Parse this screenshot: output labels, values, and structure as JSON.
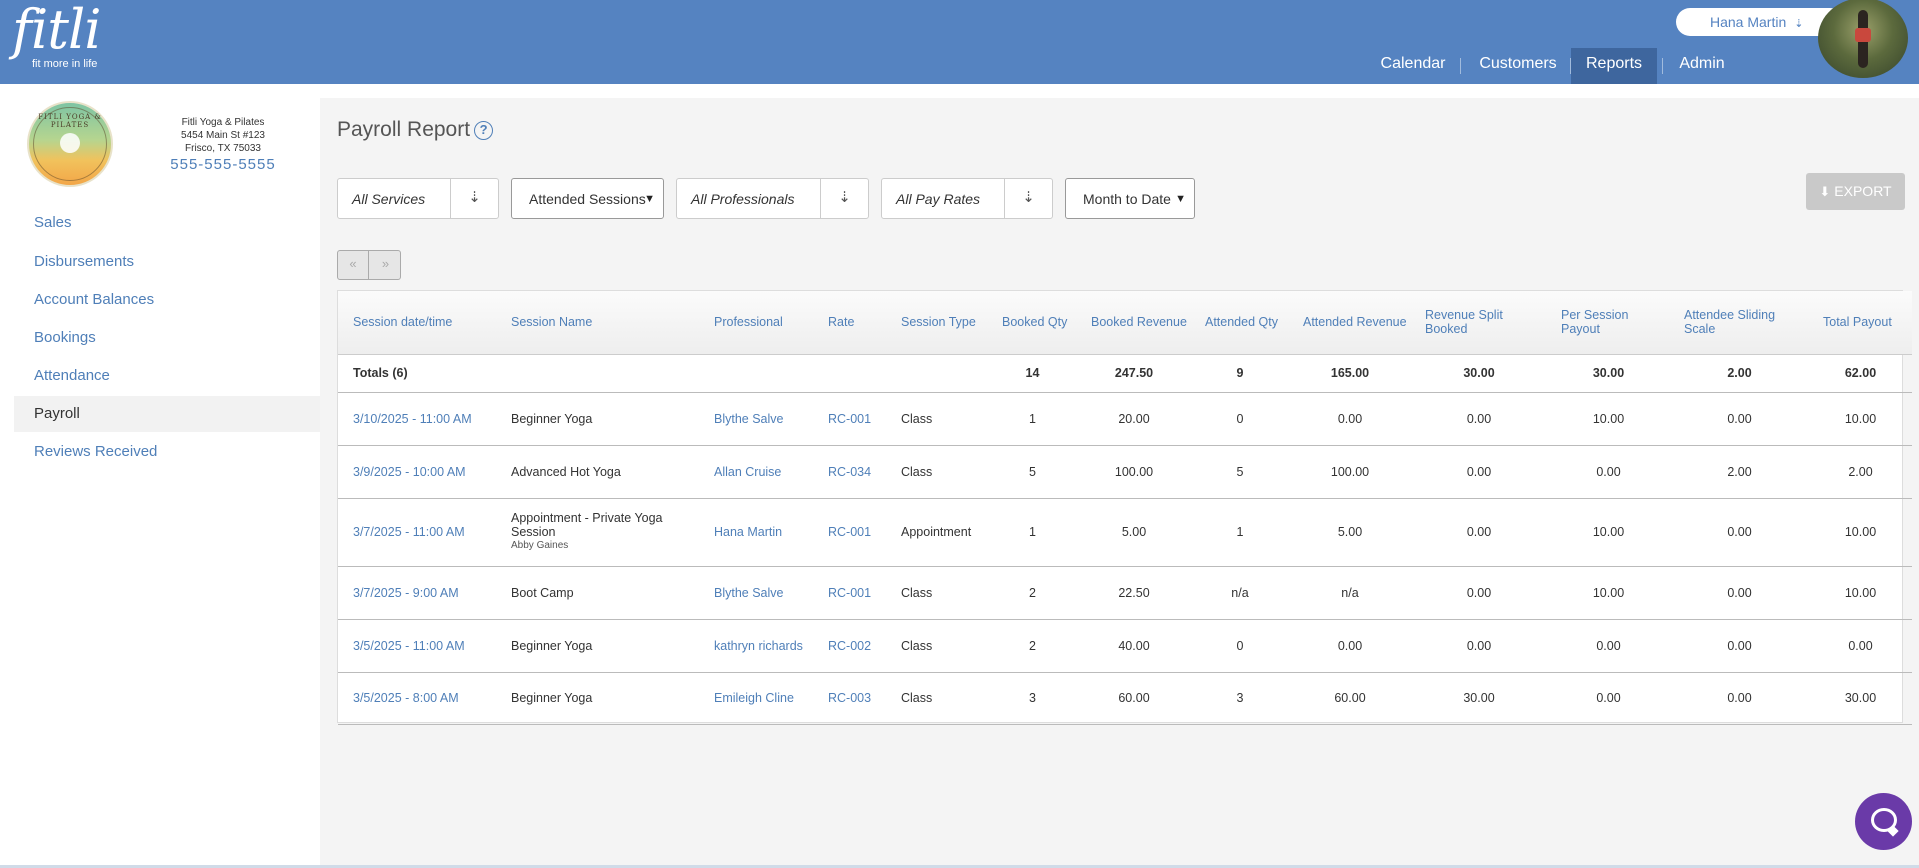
{
  "brand": {
    "name": "fitli",
    "tagline": "fit more in life"
  },
  "header": {
    "user_name": "Hana Martin",
    "nav": [
      "Calendar",
      "Customers",
      "Reports",
      "Admin"
    ],
    "active_nav": "Reports"
  },
  "business": {
    "logo_text": "FITLI YOGA & PILATES",
    "name": "Fitli Yoga & Pilates",
    "address1": "5454 Main St #123",
    "address2": "Frisco, TX 75033",
    "phone": "555-555-5555"
  },
  "sidebar": {
    "items": [
      "Sales",
      "Disbursements",
      "Account Balances",
      "Bookings",
      "Attendance",
      "Payroll",
      "Reviews Received"
    ],
    "active": "Payroll"
  },
  "page": {
    "title": "Payroll Report",
    "help": "?"
  },
  "filters": {
    "services": "All Services",
    "session_filter": "Attended Sessions",
    "professionals": "All Professionals",
    "pay_rates": "All Pay Rates",
    "period": "Month to Date"
  },
  "export_label": "EXPORT",
  "pager": {
    "prev": "«",
    "next": "»"
  },
  "table": {
    "columns": [
      "Session date/time",
      "Session Name",
      "Professional",
      "Rate",
      "Session Type",
      "Booked Qty",
      "Booked Revenue",
      "Attended Qty",
      "Attended Revenue",
      "Revenue Split Booked",
      "Per Session Payout",
      "Attendee Sliding Scale",
      "Total Payout"
    ],
    "totals": {
      "label": "Totals (6)",
      "booked_qty": "14",
      "booked_revenue": "247.50",
      "attended_qty": "9",
      "attended_revenue": "165.00",
      "revenue_split": "30.00",
      "per_session": "30.00",
      "sliding_scale": "2.00",
      "total_payout": "62.00"
    },
    "rows": [
      {
        "datetime": "3/10/2025 - 11:00 AM",
        "name": "Beginner Yoga",
        "sub": "",
        "professional": "Blythe Salve",
        "rate": "RC-001",
        "type": "Class",
        "booked_qty": "1",
        "booked_revenue": "20.00",
        "attended_qty": "0",
        "attended_revenue": "0.00",
        "revenue_split": "0.00",
        "per_session": "10.00",
        "sliding_scale": "0.00",
        "total_payout": "10.00"
      },
      {
        "datetime": "3/9/2025 - 10:00 AM",
        "name": "Advanced Hot Yoga",
        "sub": "",
        "professional": "Allan Cruise",
        "rate": "RC-034",
        "type": "Class",
        "booked_qty": "5",
        "booked_revenue": "100.00",
        "attended_qty": "5",
        "attended_revenue": "100.00",
        "revenue_split": "0.00",
        "per_session": "0.00",
        "sliding_scale": "2.00",
        "total_payout": "2.00"
      },
      {
        "datetime": "3/7/2025 - 11:00 AM",
        "name": "Appointment - Private Yoga Session",
        "sub": "Abby Gaines",
        "professional": "Hana Martin",
        "rate": "RC-001",
        "type": "Appointment",
        "booked_qty": "1",
        "booked_revenue": "5.00",
        "attended_qty": "1",
        "attended_revenue": "5.00",
        "revenue_split": "0.00",
        "per_session": "10.00",
        "sliding_scale": "0.00",
        "total_payout": "10.00"
      },
      {
        "datetime": "3/7/2025 - 9:00 AM",
        "name": "Boot Camp",
        "sub": "",
        "professional": "Blythe Salve",
        "rate": "RC-001",
        "type": "Class",
        "booked_qty": "2",
        "booked_revenue": "22.50",
        "attended_qty": "n/a",
        "attended_revenue": "n/a",
        "revenue_split": "0.00",
        "per_session": "10.00",
        "sliding_scale": "0.00",
        "total_payout": "10.00"
      },
      {
        "datetime": "3/5/2025 - 11:00 AM",
        "name": "Beginner Yoga",
        "sub": "",
        "professional": "kathryn richards",
        "rate": "RC-002",
        "type": "Class",
        "booked_qty": "2",
        "booked_revenue": "40.00",
        "attended_qty": "0",
        "attended_revenue": "0.00",
        "revenue_split": "0.00",
        "per_session": "0.00",
        "sliding_scale": "0.00",
        "total_payout": "0.00"
      },
      {
        "datetime": "3/5/2025 - 8:00 AM",
        "name": "Beginner Yoga",
        "sub": "",
        "professional": "Emileigh Cline",
        "rate": "RC-003",
        "type": "Class",
        "booked_qty": "3",
        "booked_revenue": "60.00",
        "attended_qty": "3",
        "attended_revenue": "60.00",
        "revenue_split": "30.00",
        "per_session": "0.00",
        "sliding_scale": "0.00",
        "total_payout": "30.00"
      }
    ]
  },
  "colors": {
    "header": "#5583c1",
    "active_nav": "#3e669e",
    "link": "#4f7fb8",
    "chat": "#6a3aa8"
  },
  "icons": {
    "help": "question-circle-icon",
    "export": "download-icon",
    "dropdown": "double-chevron-down-icon",
    "chat": "chat-bubble-icon"
  }
}
